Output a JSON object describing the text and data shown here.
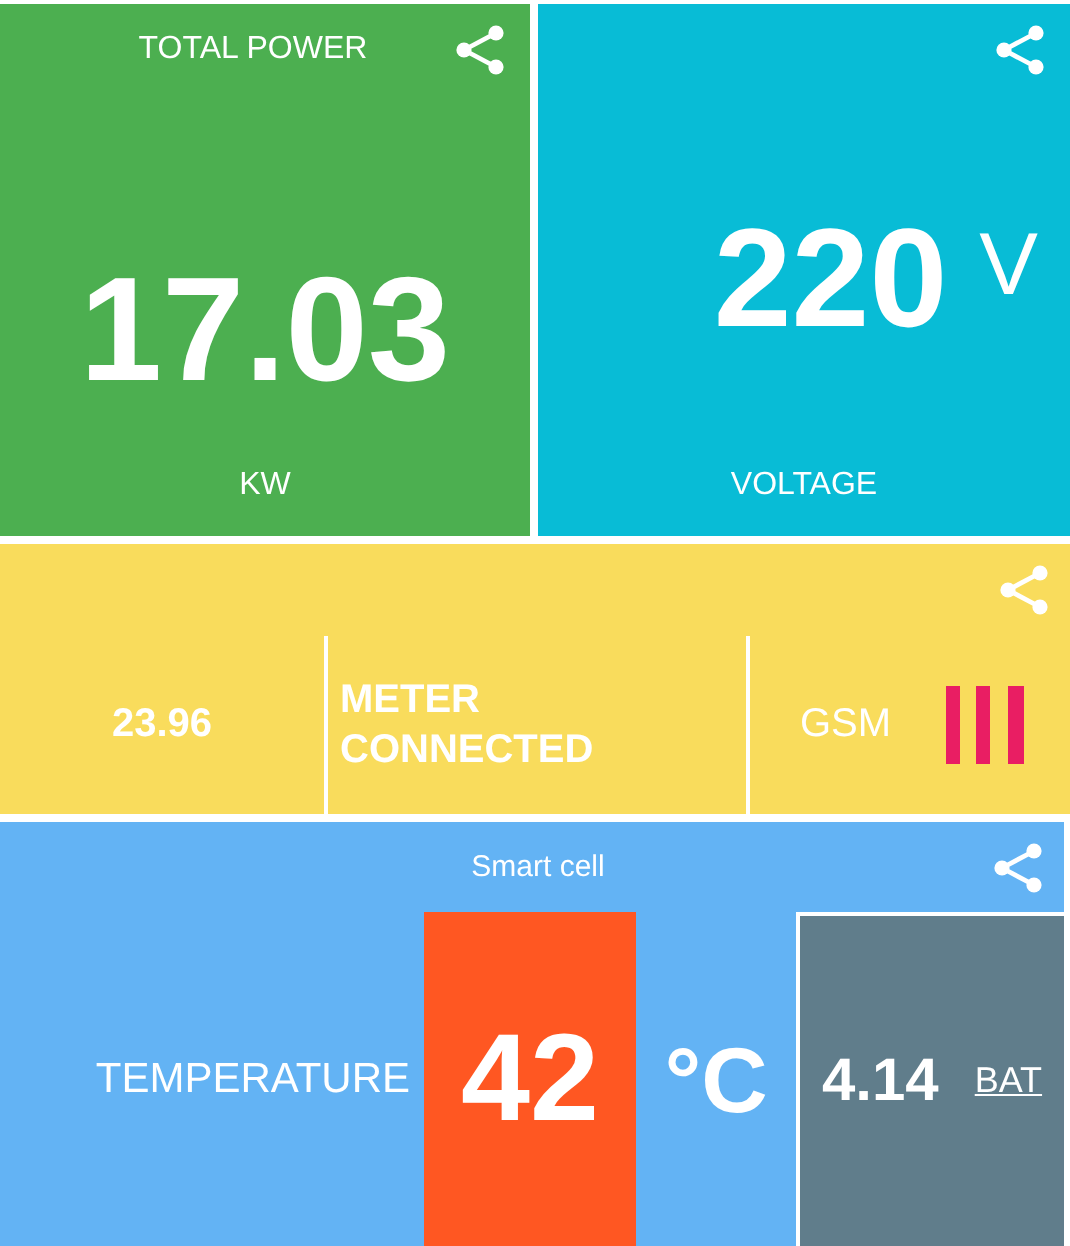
{
  "tiles": [
    {
      "kind": "power",
      "title": "TOTAL POWER",
      "value": "17.03",
      "label": "KW"
    },
    {
      "kind": "voltage",
      "value": "220",
      "unit": "V",
      "label": "VOLTAGE"
    }
  ],
  "status": {
    "reading": "23.96",
    "message": "METER CONNECTED",
    "network": "GSM"
  },
  "cell": {
    "title": "Smart cell",
    "temperature_label": "TEMPERATURE",
    "temperature": "42",
    "temperature_unit": "°C",
    "battery": "4.14",
    "battery_label": "BAT"
  }
}
